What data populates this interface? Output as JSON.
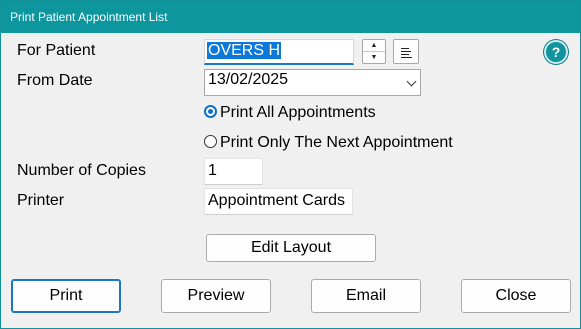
{
  "window": {
    "title": "Print Patient Appointment List"
  },
  "form": {
    "patient_label": "For Patient",
    "patient_value": "OVERS H",
    "from_date_label": "From Date",
    "from_date_value": "13/02/2025",
    "radio_all_label": "Print All Appointments",
    "radio_next_label": "Print Only The Next Appointment",
    "selected_option": "all",
    "copies_label": "Number of Copies",
    "copies_value": "1",
    "printer_label": "Printer",
    "printer_value": "Appointment Cards",
    "help_symbol": "?",
    "spin_up_symbol": "▲",
    "spin_down_symbol": "▼"
  },
  "buttons": {
    "edit_layout": "Edit Layout",
    "print": "Print",
    "preview": "Preview",
    "email": "Email",
    "close": "Close"
  }
}
